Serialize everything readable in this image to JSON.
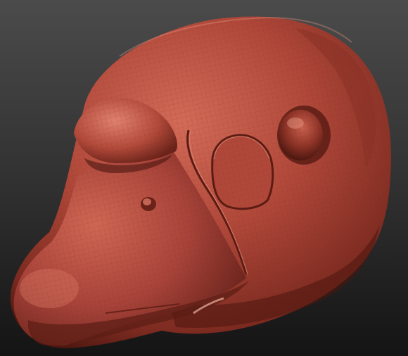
{
  "viewport": {
    "background_top": "#4b4b4b",
    "background_bottom": "#141414"
  },
  "model": {
    "icon": "sculpt-mesh-head",
    "material_base": "#b0483a",
    "material_highlight": "#e1816f",
    "material_shadow": "#4a160f",
    "wire_color": "#6e2418"
  }
}
